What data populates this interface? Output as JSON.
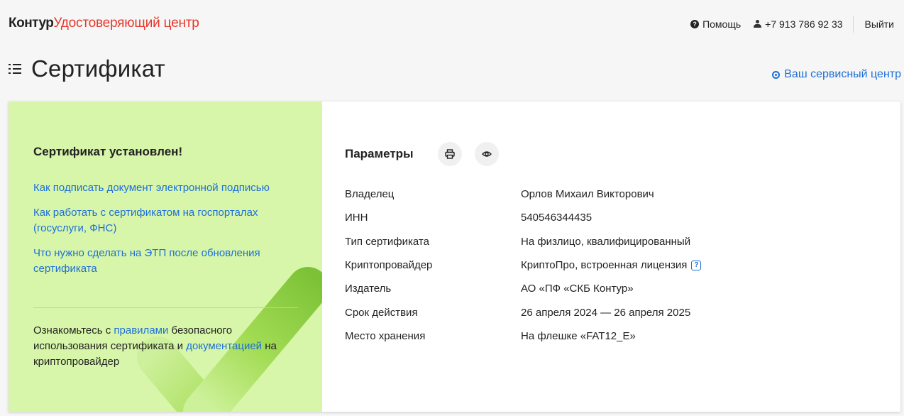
{
  "header": {
    "brand": "Контур",
    "product": "Удостоверяющий центр",
    "help_label": "Помощь",
    "phone": "+7 913 786 92 33",
    "logout_label": "Выйти"
  },
  "page": {
    "title": "Сертификат",
    "service_center_label": "Ваш сервисный центр"
  },
  "left_panel": {
    "title": "Сертификат установлен!",
    "links": [
      "Как подписать документ электронной подписью",
      "Как работать с сертификатом на госпорталах (госуслуги, ФНС)",
      "Что нужно сделать на ЭТП после обновления сертификата"
    ],
    "rules": {
      "prefix": "Ознакомьтесь с ",
      "rules_link": "правилами",
      "middle": " безопасного использования сертификата и ",
      "docs_link": "документацией",
      "suffix": " на криптопровайдер"
    }
  },
  "params": {
    "title": "Параметры",
    "rows": [
      {
        "key": "Владелец",
        "value": "Орлов Михаил Викторович"
      },
      {
        "key": "ИНН",
        "value": "540546344435"
      },
      {
        "key": "Тип сертификата",
        "value": "На физлицо, квалифицированный"
      },
      {
        "key": "Криптопровайдер",
        "value": "КриптоПро, встроенная лицензия"
      },
      {
        "key": "Издатель",
        "value": "АО «ПФ «СКБ Контур»"
      },
      {
        "key": "Срок действия",
        "value": "26 апреля 2024 — 26 апреля 2025"
      },
      {
        "key": "Место хранения",
        "value": "На флешке «FAT12_E»"
      }
    ],
    "info_badge": "?"
  },
  "icons": {
    "help": "question-circle-icon",
    "user": "user-icon",
    "menu": "menu-icon",
    "location": "location-pin-icon",
    "print": "printer-icon",
    "view": "eye-icon",
    "check": "checkmark-icon"
  },
  "colors": {
    "background": "#f6f6f6",
    "panel_green": "#d7f6a9",
    "check_green": "#7dc234",
    "link_blue": "#1e6fd9",
    "brand_red": "#e8372a",
    "text": "#222222"
  }
}
